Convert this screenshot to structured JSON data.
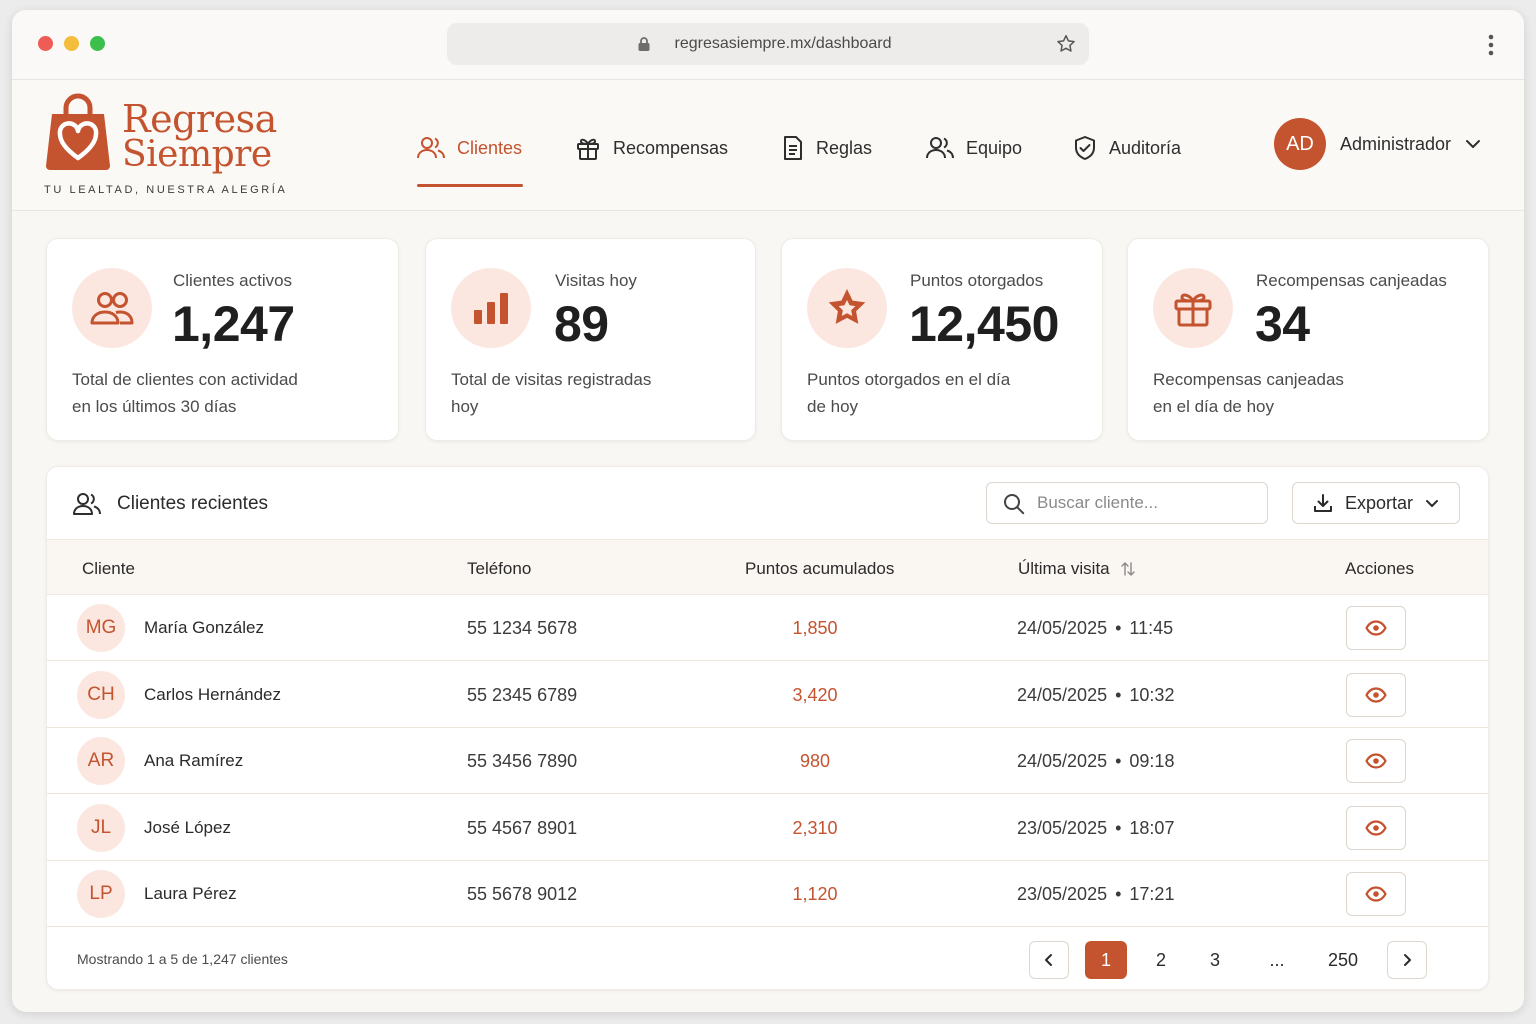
{
  "browser": {
    "url": "regresasiempre.mx/dashboard"
  },
  "brand": {
    "name_line1": "Regresa",
    "name_line2": "Siempre",
    "tagline": "TU LEALTAD, NUESTRA ALEGRÍA",
    "accent_color": "#c4532f"
  },
  "nav": {
    "items": [
      {
        "label": "Clientes",
        "icon": "users-icon",
        "active": true
      },
      {
        "label": "Recompensas",
        "icon": "gift-icon"
      },
      {
        "label": "Reglas",
        "icon": "document-icon"
      },
      {
        "label": "Equipo",
        "icon": "team-icon"
      },
      {
        "label": "Auditoría",
        "icon": "shield-check-icon"
      }
    ]
  },
  "user": {
    "initials": "AD",
    "name": "Administrador"
  },
  "stats": [
    {
      "label": "Clientes activos",
      "value": "1,247",
      "desc_line1": "Total de clientes con actividad",
      "desc_line2": "en los últimos 30 días",
      "icon": "users-icon"
    },
    {
      "label": "Visitas hoy",
      "value": "89",
      "desc_line1": "Total de visitas registradas",
      "desc_line2": "hoy",
      "icon": "bar-chart-icon"
    },
    {
      "label": "Puntos otorgados",
      "value": "12,450",
      "desc_line1": "Puntos otorgados en el día",
      "desc_line2": "de hoy",
      "icon": "star-icon"
    },
    {
      "label": "Recompensas canjeadas",
      "value": "34",
      "desc_line1": "Recompensas canjeadas",
      "desc_line2": "en el día de hoy",
      "icon": "gift-icon"
    }
  ],
  "recent": {
    "title": "Clientes recientes",
    "search_placeholder": "Buscar cliente...",
    "export_label": "Exportar",
    "columns": {
      "client": "Cliente",
      "phone": "Teléfono",
      "points": "Puntos acumulados",
      "last_visit": "Última visita",
      "actions": "Acciones"
    },
    "rows": [
      {
        "initials": "MG",
        "name": "María González",
        "phone": "55 1234 5678",
        "points": "1,850",
        "date": "24/05/2025",
        "time": "11:45"
      },
      {
        "initials": "CH",
        "name": "Carlos Hernández",
        "phone": "55 2345 6789",
        "points": "3,420",
        "date": "24/05/2025",
        "time": "10:32"
      },
      {
        "initials": "AR",
        "name": "Ana Ramírez",
        "phone": "55 3456 7890",
        "points": "980",
        "date": "24/05/2025",
        "time": "09:18"
      },
      {
        "initials": "JL",
        "name": "José López",
        "phone": "55 4567 8901",
        "points": "2,310",
        "date": "23/05/2025",
        "time": "18:07"
      },
      {
        "initials": "LP",
        "name": "Laura Pérez",
        "phone": "55 5678 9012",
        "points": "1,120",
        "date": "23/05/2025",
        "time": "17:21"
      }
    ],
    "footer_text": "Mostrando 1 a 5 de 1,247 clientes",
    "pagination": {
      "pages": [
        "1",
        "2",
        "3",
        "...",
        "250"
      ],
      "current": "1"
    }
  }
}
